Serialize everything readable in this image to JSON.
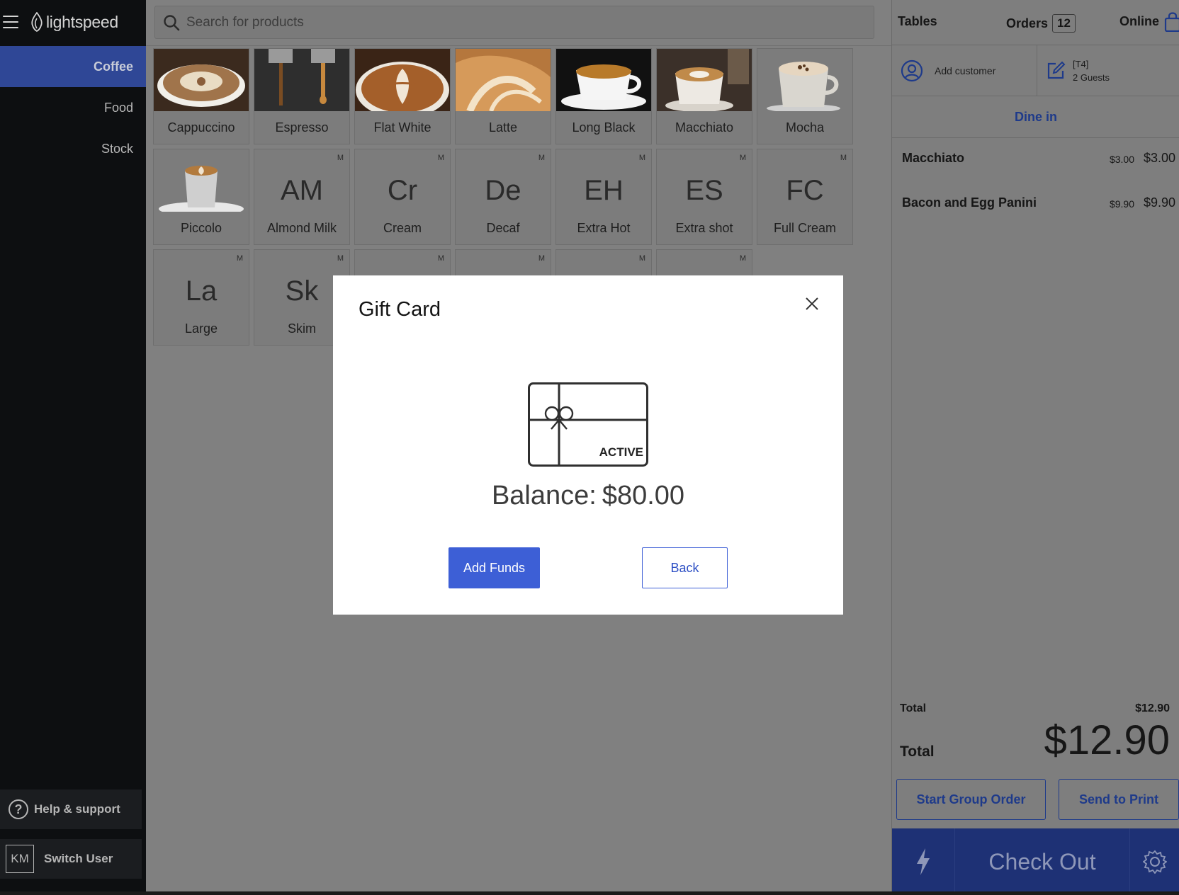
{
  "brand": {
    "name": "lightspeed"
  },
  "sidebar": {
    "categories": [
      {
        "label": "Coffee",
        "active": true
      },
      {
        "label": "Food",
        "active": false
      },
      {
        "label": "Stock",
        "active": false
      }
    ],
    "help_label": "Help & support",
    "help_glyph": "?",
    "user_initials": "KM",
    "switch_user_label": "Switch User"
  },
  "search": {
    "placeholder": "Search for products",
    "value": ""
  },
  "products": [
    {
      "label": "Cappuccino",
      "photo": "cappuccino"
    },
    {
      "label": "Espresso",
      "photo": "espresso"
    },
    {
      "label": "Flat White",
      "photo": "flat-white"
    },
    {
      "label": "Latte",
      "photo": "latte"
    },
    {
      "label": "Long Black",
      "photo": "long-black"
    },
    {
      "label": "Macchiato",
      "photo": "macchiato"
    },
    {
      "label": "Mocha",
      "photo": "mocha"
    },
    {
      "label": "Piccolo",
      "photo": "piccolo"
    }
  ],
  "modifiers": [
    {
      "abbr": "AM",
      "label": "Almond Milk",
      "badge": "M"
    },
    {
      "abbr": "Cr",
      "label": "Cream",
      "badge": "M"
    },
    {
      "abbr": "De",
      "label": "Decaf",
      "badge": "M"
    },
    {
      "abbr": "EH",
      "label": "Extra Hot",
      "badge": "M"
    },
    {
      "abbr": "ES",
      "label": "Extra shot",
      "badge": "M"
    },
    {
      "abbr": "FC",
      "label": "Full Cream",
      "badge": "M"
    },
    {
      "abbr": "La",
      "label": "Large",
      "badge": "M"
    },
    {
      "abbr": "Sk",
      "label": "Skim",
      "badge": "M"
    }
  ],
  "hidden_tiles_badge": "M",
  "order": {
    "tables_label": "Tables",
    "orders_label": "Orders",
    "orders_count": "12",
    "online_label": "Online",
    "add_customer_label": "Add customer",
    "table_code": "[T4]",
    "guests": "2 Guests",
    "dine_mode": "Dine in",
    "items": [
      {
        "name": "Macchiato",
        "unit_price": "$3.00",
        "total": "$3.00"
      },
      {
        "name": "Bacon and Egg Panini",
        "unit_price": "$9.90",
        "total": "$9.90"
      }
    ],
    "subtotal_label": "Total",
    "subtotal_value": "$12.90",
    "total_label": "Total",
    "total_value": "$12.90",
    "start_group_label": "Start Group Order",
    "send_print_label": "Send to Print",
    "checkout_label": "Check Out"
  },
  "modal": {
    "title": "Gift Card",
    "status": "ACTIVE",
    "balance_label": "Balance:",
    "balance_value": "$80.00",
    "add_funds_label": "Add Funds",
    "back_label": "Back"
  },
  "colors": {
    "accent": "#3d5fd6",
    "sidebar_active": "#2f4796",
    "checkout_bar": "#1e3175",
    "link_text": "#1e3a8a",
    "overlay_gray": "#808080"
  }
}
